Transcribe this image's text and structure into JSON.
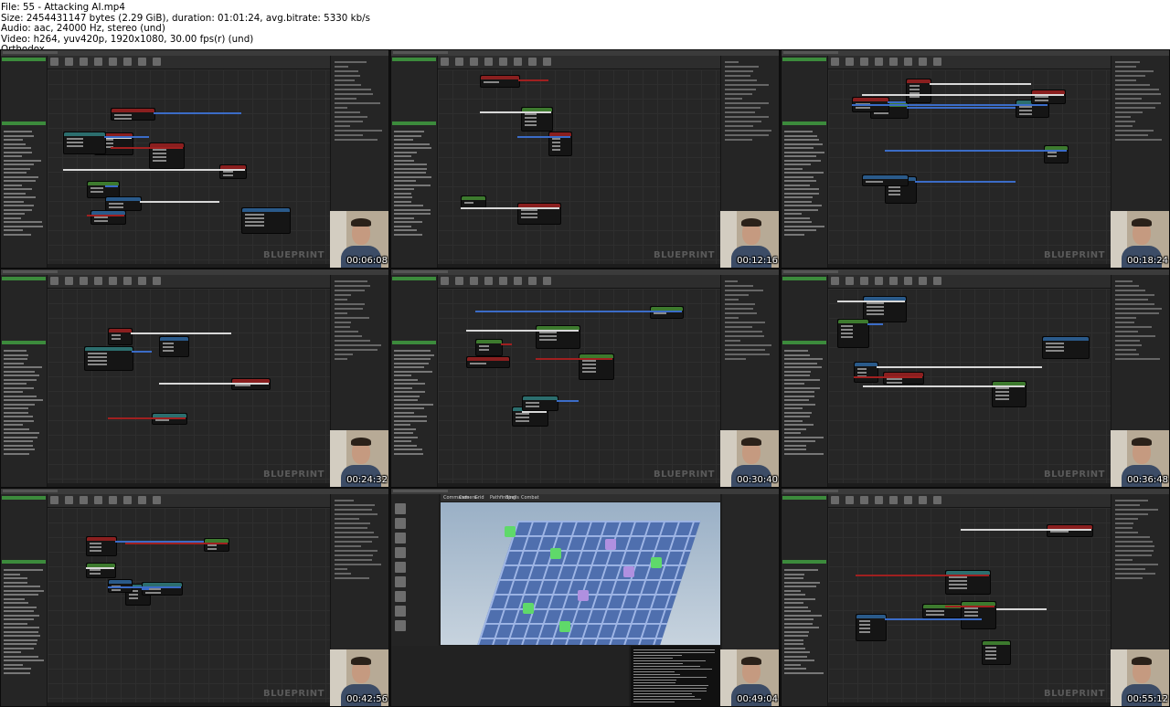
{
  "header": {
    "lines": [
      "File: 55 - Attacking AI.mp4",
      "Size: 2454431147 bytes (2.29 GiB), duration: 01:01:24, avg.bitrate: 5330 kb/s",
      "Audio: aac, 24000 Hz, stereo (und)",
      "Video: h264, yuv420p, 1920x1080, 30.00 fps(r) (und)",
      "Orthodox"
    ]
  },
  "editor_watermark": "BLUEPRINT",
  "viewport_tabs": [
    "Commands",
    "Camera",
    "Grid",
    "Pathfinding",
    "Spells",
    "Combat"
  ],
  "thumbnails": [
    {
      "timestamp": "00:06:08",
      "kind": "blueprint"
    },
    {
      "timestamp": "00:12:16",
      "kind": "blueprint"
    },
    {
      "timestamp": "00:18:24",
      "kind": "blueprint"
    },
    {
      "timestamp": "00:24:32",
      "kind": "blueprint"
    },
    {
      "timestamp": "00:30:40",
      "kind": "blueprint"
    },
    {
      "timestamp": "00:36:48",
      "kind": "blueprint"
    },
    {
      "timestamp": "00:42:56",
      "kind": "blueprint"
    },
    {
      "timestamp": "00:49:04",
      "kind": "viewport"
    },
    {
      "timestamp": "00:55:12",
      "kind": "blueprint"
    }
  ],
  "colors": {
    "node_header_green": "#3d7a2e",
    "node_header_red": "#8a1f1f",
    "node_header_blue": "#2a5a8a",
    "node_header_teal": "#2c6e6e",
    "wire_white": "#d8d8d8",
    "wire_blue": "#3b6cc7",
    "wire_red": "#a02020",
    "tile_blue": "#4f6fae",
    "cube_green": "#5fd96a",
    "cube_purple": "#b090e0"
  }
}
